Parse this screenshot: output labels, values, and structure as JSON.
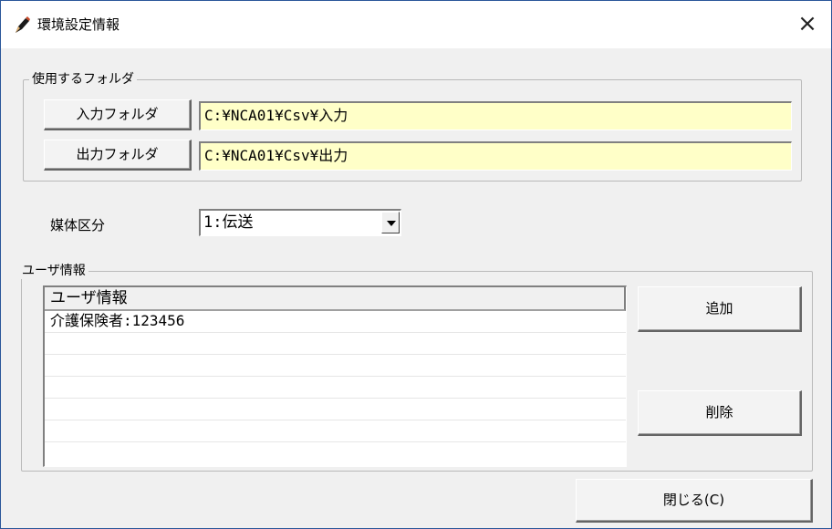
{
  "window": {
    "title": "環境設定情報",
    "close_label": "×"
  },
  "folders": {
    "group_label": "使用するフォルダ",
    "input_button_label": "入力フォルダ",
    "input_path": "C:¥NCA01¥Csv¥入力",
    "output_button_label": "出力フォルダ",
    "output_path": "C:¥NCA01¥Csv¥出力"
  },
  "media": {
    "label": "媒体区分",
    "selected": "1:伝送"
  },
  "user_info": {
    "group_label": "ユーザ情報",
    "column_header": "ユーザ情報",
    "rows": [
      "介護保険者:123456",
      "",
      "",
      "",
      "",
      ""
    ],
    "add_button_label": "追加",
    "delete_button_label": "削除"
  },
  "footer": {
    "close_button_label": "閉じる(C)"
  },
  "colors": {
    "path_field_bg": "#ffffc8",
    "window_border": "#2b579a"
  }
}
